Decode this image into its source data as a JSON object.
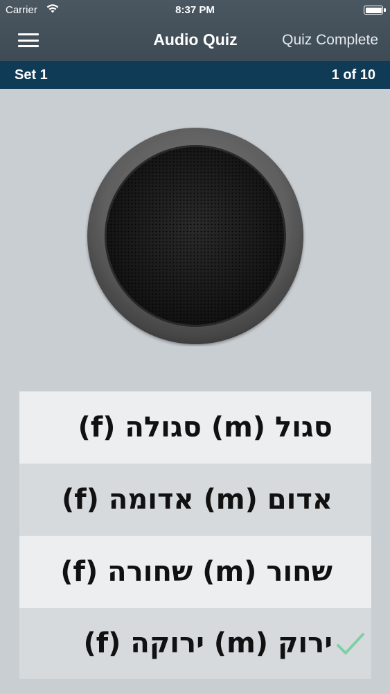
{
  "status": {
    "carrier": "Carrier",
    "time": "8:37 PM"
  },
  "nav": {
    "title": "Audio Quiz",
    "right_label": "Quiz Complete"
  },
  "quiz": {
    "set_label": "Set 1",
    "progress_label": "1 of 10"
  },
  "answers": [
    {
      "text": "סגול (m)  סגולה (f)",
      "selected": false
    },
    {
      "text": "אדום (m)  אדומה (f)",
      "selected": false
    },
    {
      "text": "שחור (m)  שחורה (f)",
      "selected": false
    },
    {
      "text": "ירוק (m)  ירוקה (f)",
      "selected": true
    }
  ],
  "colors": {
    "nav_background": "#44515b",
    "set_bar": "#0f3b57",
    "page_background": "#c9ced3",
    "check": "#7fcfa7"
  },
  "icons": {
    "menu": "hamburger-menu-icon",
    "speaker": "speaker-icon",
    "check": "check-icon",
    "wifi": "wifi-icon",
    "battery": "battery-icon"
  }
}
